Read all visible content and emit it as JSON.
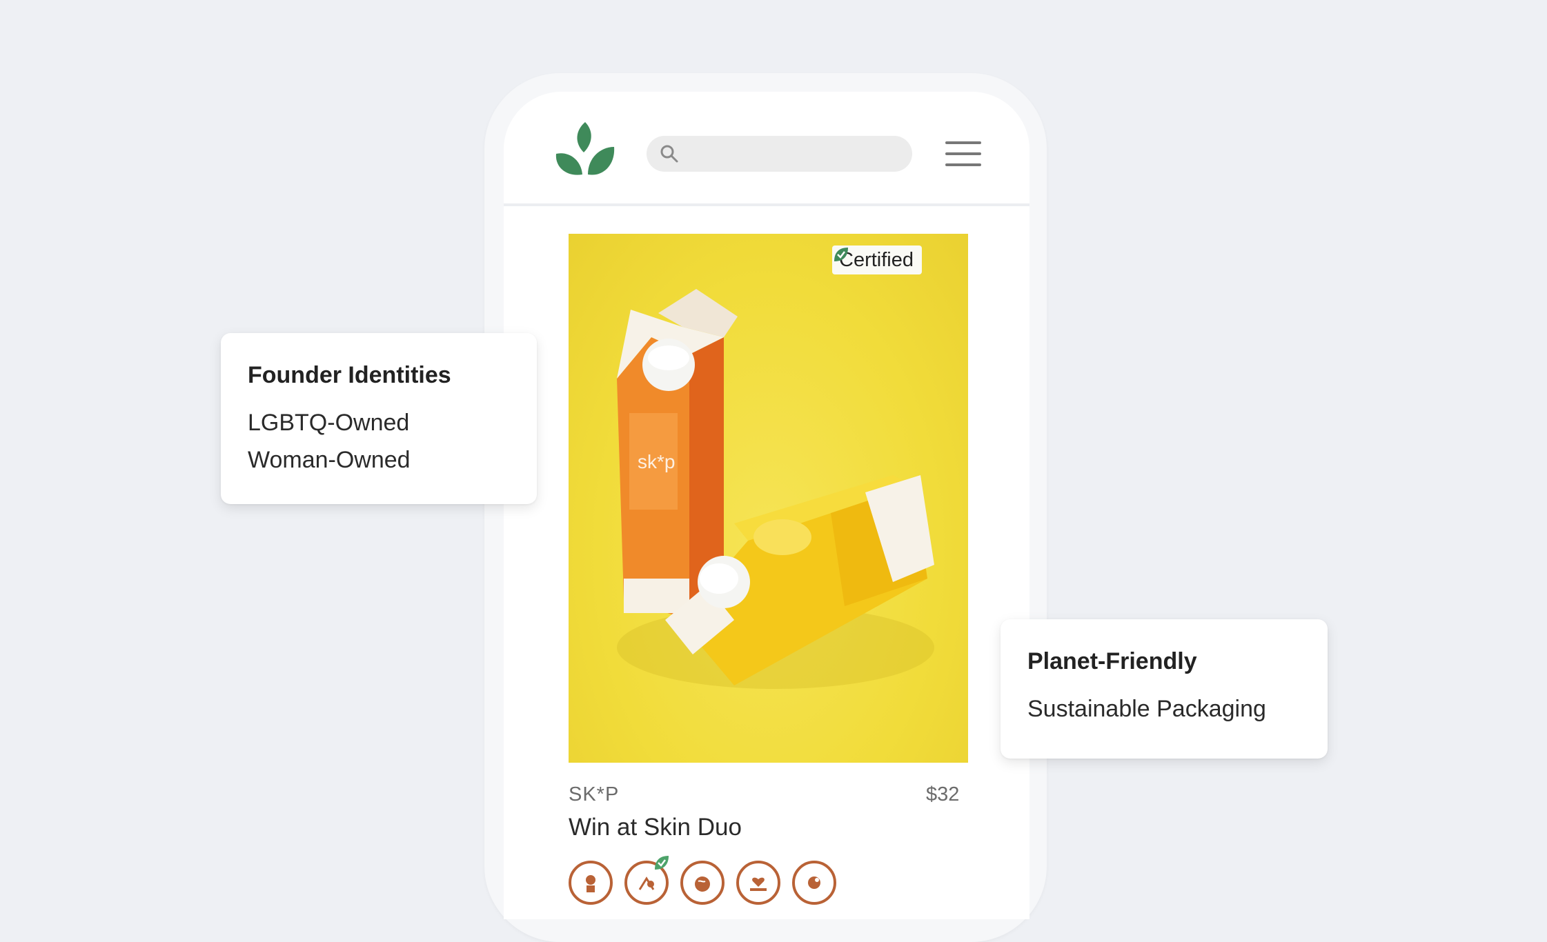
{
  "header": {
    "logo_icon": "leaf-logo-icon",
    "search": {
      "placeholder": "",
      "icon": "search-icon"
    },
    "menu_icon": "hamburger-menu-icon"
  },
  "product": {
    "badge": {
      "label": "Certified",
      "icon": "leaf-check-icon",
      "color": "#3f8a5a"
    },
    "brand": "SK*P",
    "price": "$32",
    "name": "Win at Skin Duo",
    "value_icons": [
      "founder-icon",
      "certified-value-icon",
      "globe-icon",
      "heart-hand-icon",
      "community-icon"
    ]
  },
  "cards": {
    "founder": {
      "title": "Founder Identities",
      "items": [
        "LGBTQ-Owned",
        "Woman-Owned"
      ]
    },
    "planet": {
      "title": "Planet-Friendly",
      "items": [
        "Sustainable Packaging"
      ]
    }
  },
  "colors": {
    "background": "#eef0f4",
    "brand_green": "#3f8a5a",
    "icon_accent": "#b96236",
    "product_bg": "#f1dc3a"
  }
}
